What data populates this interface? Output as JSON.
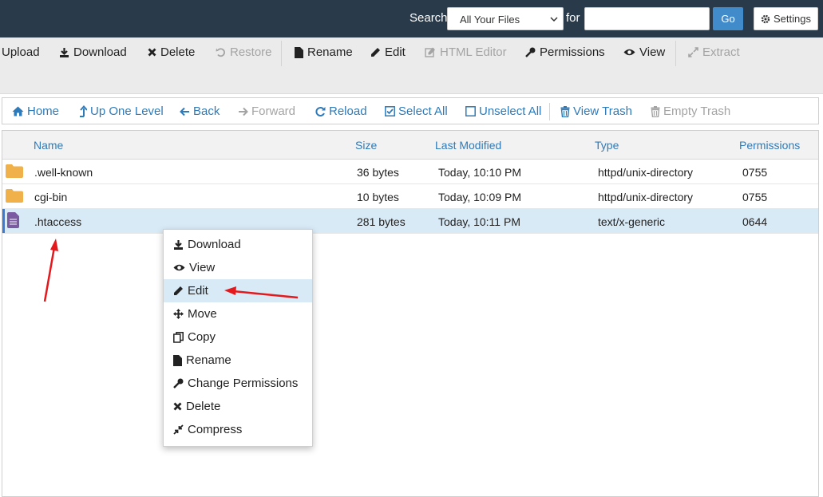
{
  "topbar": {
    "search_label": "Search",
    "search_scope": "All Your Files",
    "for_label": "for",
    "search_value": "",
    "go_label": "Go",
    "settings_label": "Settings"
  },
  "toolbar": {
    "upload": "Upload",
    "download": "Download",
    "delete": "Delete",
    "restore": "Restore",
    "rename": "Rename",
    "edit": "Edit",
    "html_editor": "HTML Editor",
    "permissions": "Permissions",
    "view": "View",
    "extract": "Extract"
  },
  "nav": {
    "home": "Home",
    "up_one_level": "Up One Level",
    "back": "Back",
    "forward": "Forward",
    "reload": "Reload",
    "select_all": "Select All",
    "unselect_all": "Unselect All",
    "view_trash": "View Trash",
    "empty_trash": "Empty Trash"
  },
  "table": {
    "headers": {
      "name": "Name",
      "size": "Size",
      "modified": "Last Modified",
      "type": "Type",
      "permissions": "Permissions"
    },
    "rows": [
      {
        "name": ".well-known",
        "size": "36 bytes",
        "modified": "Today, 10:10 PM",
        "type": "httpd/unix-directory",
        "perms": "0755",
        "icon": "folder-icon"
      },
      {
        "name": "cgi-bin",
        "size": "10 bytes",
        "modified": "Today, 10:09 PM",
        "type": "httpd/unix-directory",
        "perms": "0755",
        "icon": "folder-icon"
      },
      {
        "name": ".htaccess",
        "size": "281 bytes",
        "modified": "Today, 10:11 PM",
        "type": "text/x-generic",
        "perms": "0644",
        "icon": "file-text-icon",
        "selected": true
      }
    ]
  },
  "context_menu": {
    "items": [
      {
        "label": "Download",
        "icon": "download-icon"
      },
      {
        "label": "View",
        "icon": "eye-icon"
      },
      {
        "label": "Edit",
        "icon": "pencil-icon",
        "highlighted": true
      },
      {
        "label": "Move",
        "icon": "move-icon"
      },
      {
        "label": "Copy",
        "icon": "copy-icon"
      },
      {
        "label": "Rename",
        "icon": "file-icon"
      },
      {
        "label": "Change Permissions",
        "icon": "key-icon"
      },
      {
        "label": "Delete",
        "icon": "x-icon"
      },
      {
        "label": "Compress",
        "icon": "compress-icon"
      }
    ]
  },
  "colors": {
    "topbar": "#293a4a",
    "link": "#2f7ab8",
    "go_button": "#428bca",
    "selected_row": "#d9eaf7",
    "annotation_arrow": "#e3191d",
    "folder": "#f0b04a",
    "file": "#7a5aa0"
  }
}
